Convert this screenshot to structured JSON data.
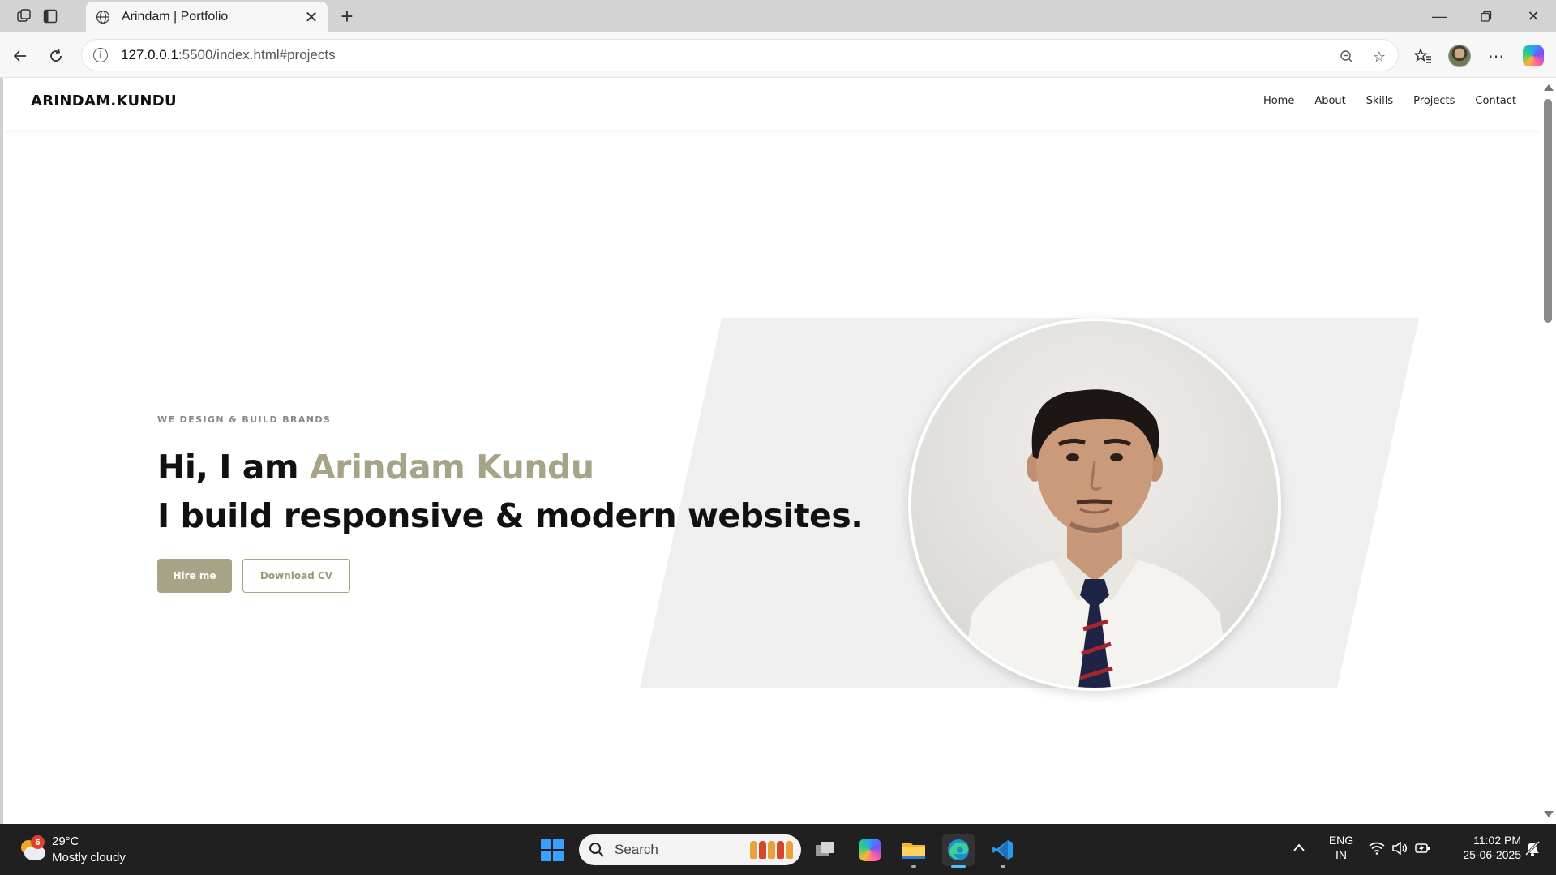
{
  "browser": {
    "tab_title": "Arindam | Portfolio",
    "url_host": "127.0.0.1",
    "url_rest": ":5500/index.html#projects"
  },
  "site": {
    "logo": "ARINDAM.KUNDU",
    "nav": [
      "Home",
      "About",
      "Skills",
      "Projects",
      "Contact"
    ],
    "hero": {
      "eyebrow": "WE DESIGN & BUILD BRANDS",
      "greeting": "Hi, I am ",
      "name": "Arindam Kundu",
      "tagline": "I build responsive & modern websites.",
      "hire_label": "Hire me",
      "cv_label": "Download CV"
    },
    "accent_color": "#a6a386"
  },
  "taskbar": {
    "weather_temp": "29°C",
    "weather_desc": "Mostly cloudy",
    "weather_badge": "6",
    "search_placeholder": "Search",
    "lang_top": "ENG",
    "lang_bottom": "IN",
    "time": "11:02 PM",
    "date": "25-06-2025"
  }
}
